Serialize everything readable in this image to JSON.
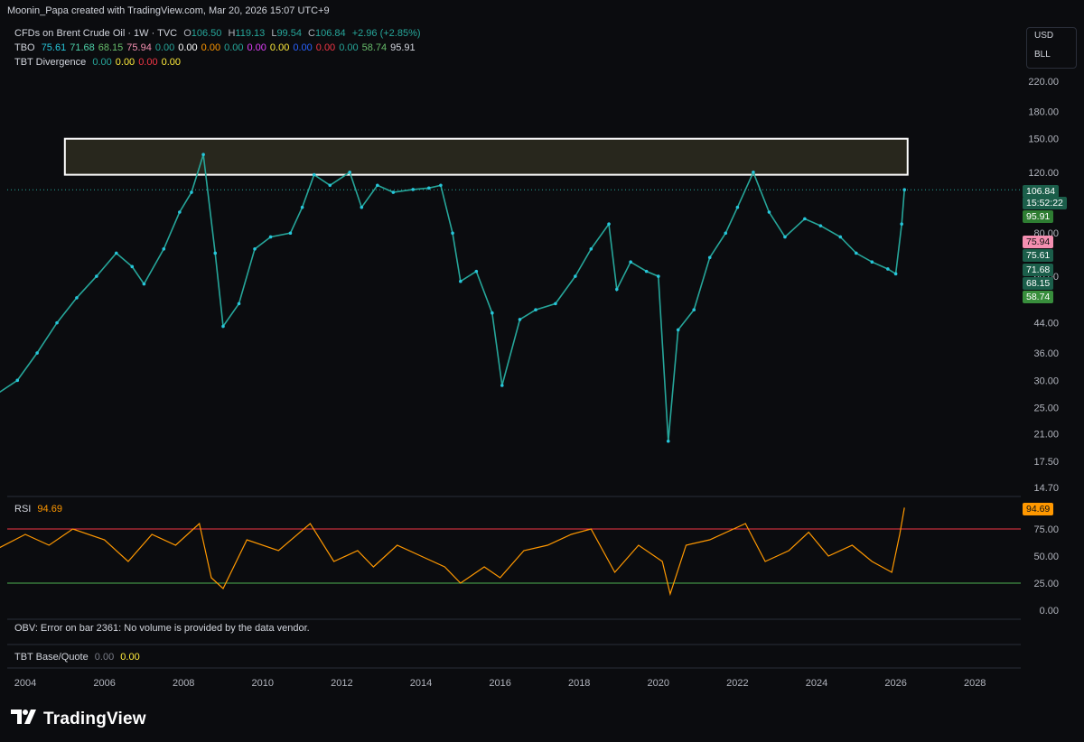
{
  "header": {
    "credit": "Moonin_Papa created with TradingView.com, Mar 20, 2026 15:07 UTC+9"
  },
  "legend": {
    "symbol": "CFDs on Brent Crude Oil · 1W · TVC",
    "o_label": "O",
    "o_val": "106.50",
    "h_label": "H",
    "h_val": "119.13",
    "l_label": "L",
    "l_val": "99.54",
    "c_label": "C",
    "c_val": "106.84",
    "change": "+2.96 (+2.85%)",
    "tbo_label": "TBO",
    "tbo_values": [
      "75.61",
      "71.68",
      "68.15",
      "75.94",
      "0.00",
      "0.00",
      "0.00",
      "0.00",
      "0.00",
      "0.00",
      "0.00",
      "0.00",
      "0.00",
      "58.74",
      "95.91"
    ],
    "tbo_colors": [
      "#26c6da",
      "#4dd0a8",
      "#66bb6a",
      "#f48fb1",
      "#26a69a",
      "#ffffff",
      "#ff9800",
      "#26a69a",
      "#e040fb",
      "#ffeb3b",
      "#2962ff",
      "#f23645",
      "#26a69a",
      "#66bb6a",
      "#d1d4dc"
    ],
    "tbt_label": "TBT Divergence",
    "tbt_values": [
      "0.00",
      "0.00",
      "0.00",
      "0.00"
    ],
    "tbt_colors": [
      "#26a69a",
      "#ffeb3b",
      "#f23645",
      "#ffeb3b"
    ]
  },
  "currency": {
    "ccy": "USD",
    "unit": "BLL"
  },
  "price_tags": [
    {
      "text": "106.84",
      "bg": "#1b5e4a"
    },
    {
      "text": "15:52:22",
      "bg": "#1b5e4a"
    },
    {
      "text": "95.91",
      "bg": "#2e7d32"
    },
    {
      "text": "75.94",
      "bg": "#f48fb1",
      "fg": "#111"
    },
    {
      "text": "75.61",
      "bg": "#1b5e4a"
    },
    {
      "text": "71.68",
      "bg": "#1b5e4a"
    },
    {
      "text": "68.15",
      "bg": "#1b5e4a"
    },
    {
      "text": "58.74",
      "bg": "#388e3c"
    }
  ],
  "rsi": {
    "label": "RSI",
    "value": "94.69",
    "tag": "94.69",
    "overbought": 75,
    "oversold": 25
  },
  "obv": {
    "message": "OBV: Error on bar 2361: No volume is provided by the data vendor."
  },
  "tbt_base": {
    "label": "TBT Base/Quote",
    "v1": "0.00",
    "v2": "0.00"
  },
  "brand": {
    "name": "TradingView"
  },
  "chart_data": {
    "type": "line",
    "title": "CFDs on Brent Crude Oil · 1W · TVC",
    "y_scale": "log",
    "y_ticks": [
      "220.00",
      "180.00",
      "150.00",
      "120.00",
      "100.00",
      "80.00",
      "60.00",
      "44.00",
      "36.00",
      "30.00",
      "25.00",
      "21.00",
      "17.50",
      "14.70"
    ],
    "x_ticks": [
      "2004",
      "2006",
      "2008",
      "2010",
      "2012",
      "2014",
      "2016",
      "2018",
      "2020",
      "2022",
      "2024",
      "2026",
      "2028"
    ],
    "ylim": [
      14.7,
      220
    ],
    "price_series": {
      "name": "CFDs on Brent Crude Oil",
      "x": [
        2003.2,
        2003.8,
        2004.3,
        2004.8,
        2005.3,
        2005.8,
        2006.3,
        2006.7,
        2007.0,
        2007.5,
        2007.9,
        2008.2,
        2008.5,
        2008.8,
        2009.0,
        2009.4,
        2009.8,
        2010.2,
        2010.7,
        2011.0,
        2011.3,
        2011.7,
        2012.2,
        2012.5,
        2012.9,
        2013.3,
        2013.8,
        2014.2,
        2014.5,
        2014.8,
        2015.0,
        2015.4,
        2015.8,
        2016.05,
        2016.5,
        2016.9,
        2017.4,
        2017.9,
        2018.3,
        2018.75,
        2018.95,
        2019.3,
        2019.7,
        2020.0,
        2020.25,
        2020.5,
        2020.9,
        2021.3,
        2021.7,
        2022.0,
        2022.4,
        2022.8,
        2023.2,
        2023.7,
        2024.1,
        2024.6,
        2025.0,
        2025.4,
        2025.8,
        2026.0,
        2026.15,
        2026.22
      ],
      "y": [
        27,
        30,
        36,
        44,
        52,
        60,
        70,
        64,
        57,
        72,
        92,
        105,
        135,
        70,
        43,
        50,
        72,
        78,
        80,
        95,
        118,
        110,
        120,
        95,
        110,
        105,
        107,
        108,
        110,
        80,
        58,
        62,
        47,
        29,
        45,
        48,
        50,
        60,
        72,
        85,
        55,
        66,
        62,
        60,
        20,
        42,
        48,
        68,
        80,
        95,
        120,
        92,
        78,
        88,
        84,
        78,
        70,
        66,
        63,
        61,
        85,
        106.8
      ]
    },
    "rsi_series": {
      "name": "RSI",
      "x": [
        2003.2,
        2004.0,
        2004.6,
        2005.2,
        2006.0,
        2006.6,
        2007.2,
        2007.8,
        2008.4,
        2008.7,
        2009.0,
        2009.6,
        2010.4,
        2011.2,
        2011.8,
        2012.4,
        2012.8,
        2013.4,
        2014.0,
        2014.6,
        2015.0,
        2015.6,
        2016.0,
        2016.6,
        2017.2,
        2017.8,
        2018.3,
        2018.9,
        2019.5,
        2020.1,
        2020.3,
        2020.7,
        2021.3,
        2022.2,
        2022.7,
        2023.3,
        2023.8,
        2024.3,
        2024.9,
        2025.4,
        2025.9,
        2026.1,
        2026.22
      ],
      "y": [
        55,
        70,
        60,
        75,
        65,
        45,
        70,
        60,
        80,
        30,
        20,
        65,
        55,
        80,
        45,
        55,
        40,
        60,
        50,
        40,
        25,
        40,
        30,
        55,
        60,
        70,
        75,
        35,
        60,
        45,
        15,
        60,
        65,
        80,
        45,
        55,
        72,
        50,
        60,
        45,
        35,
        70,
        94.69
      ]
    },
    "resistance_zone": {
      "from": 118,
      "to": 150,
      "x_start": 2005.0,
      "x_end": 2026.3
    }
  }
}
